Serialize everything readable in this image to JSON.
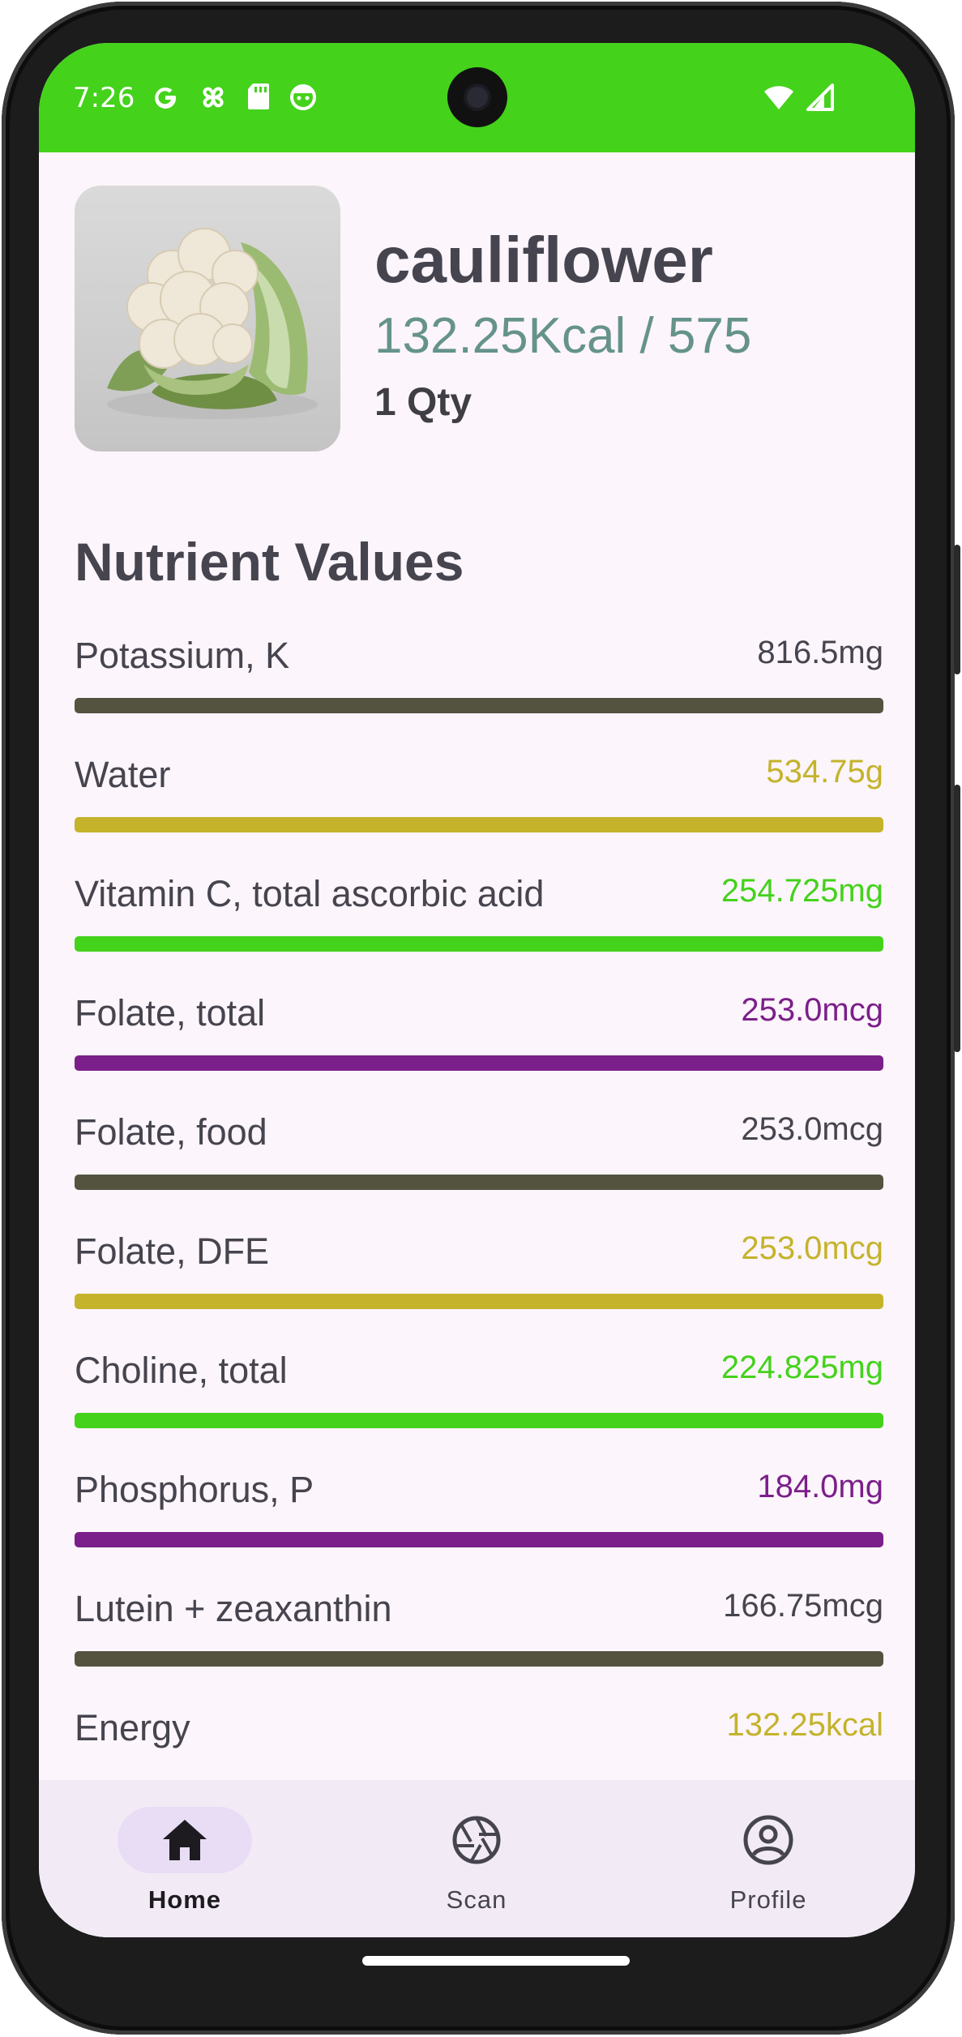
{
  "status_bar": {
    "time": "7:26",
    "icons": [
      "google-icon",
      "pinwheel-icon",
      "sd-card-icon",
      "face-icon"
    ],
    "right_icons": [
      "wifi-icon",
      "signal-icon"
    ],
    "color": "#44d21b"
  },
  "food": {
    "name": "cauliflower",
    "calories": "132.25Kcal / 575",
    "quantity": "1 Qty",
    "image": "cauliflower-photo"
  },
  "section_title": "Nutrient Values",
  "nutrients": [
    {
      "name": "Potassium, K",
      "value": "816.5mg",
      "color": "#545340",
      "fill": 1.0
    },
    {
      "name": "Water",
      "value": "534.75g",
      "color": "#c4b32b",
      "fill": 1.0
    },
    {
      "name": "Vitamin C, total ascorbic acid",
      "value": "254.725mg",
      "color": "#44d21b",
      "fill": 1.0
    },
    {
      "name": "Folate, total",
      "value": "253.0mcg",
      "color": "#7b1f8a",
      "fill": 1.0
    },
    {
      "name": "Folate, food",
      "value": "253.0mcg",
      "color": "#545340",
      "fill": 1.0
    },
    {
      "name": "Folate, DFE",
      "value": "253.0mcg",
      "color": "#c4b32b",
      "fill": 1.0
    },
    {
      "name": "Choline, total",
      "value": "224.825mg",
      "color": "#44d21b",
      "fill": 1.0
    },
    {
      "name": "Phosphorus, P",
      "value": "184.0mg",
      "color": "#7b1f8a",
      "fill": 1.0
    },
    {
      "name": "Lutein + zeaxanthin",
      "value": "166.75mcg",
      "color": "#545340",
      "fill": 1.0
    },
    {
      "name": "Energy",
      "value": "132.25kcal",
      "color": "#c4b32b",
      "fill": null
    }
  ],
  "bottom_nav": {
    "items": [
      {
        "label": "Home",
        "icon": "home-icon",
        "active": true
      },
      {
        "label": "Scan",
        "icon": "camera-aperture-icon",
        "active": false
      },
      {
        "label": "Profile",
        "icon": "account-circle-icon",
        "active": false
      }
    ],
    "active_pill_color": "#e8ddf5"
  }
}
